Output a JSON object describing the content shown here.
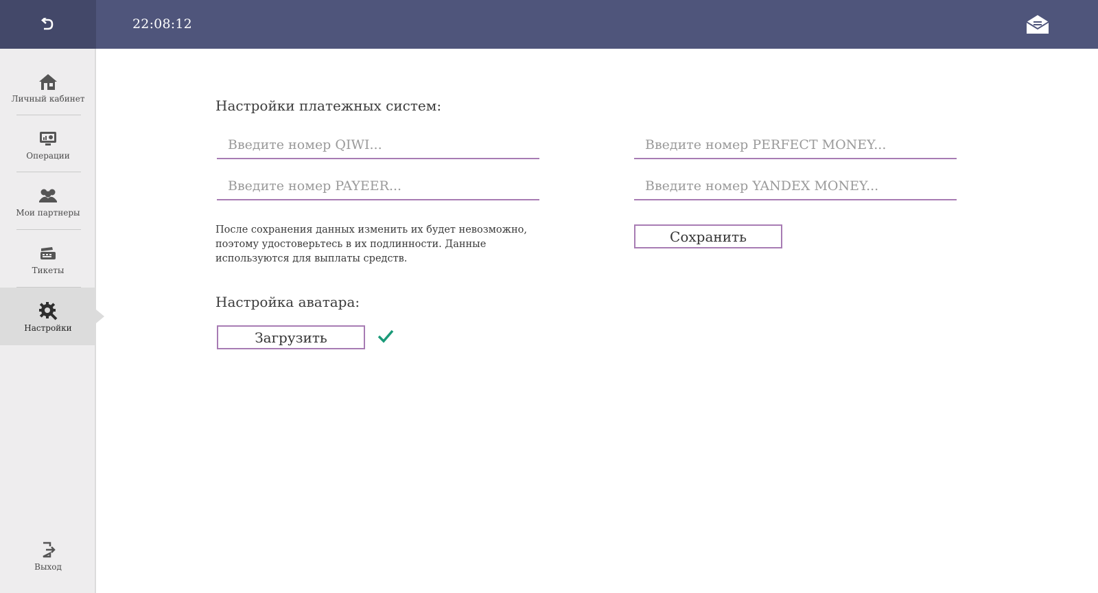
{
  "header": {
    "back_icon": "back-arrow-icon",
    "clock": "22:08:12",
    "mail_icon": "envelope-icon",
    "bg_color": "#4f557b"
  },
  "sidebar": {
    "items": [
      {
        "label": "Личный кабинет",
        "icon": "house-icon"
      },
      {
        "label": "Операции",
        "icon": "monitor-chart-icon"
      },
      {
        "label": "Мои партнеры",
        "icon": "people-icon"
      },
      {
        "label": "Тикеты",
        "icon": "ticket-icon"
      },
      {
        "label": "Настройки",
        "icon": "gear-wrench-icon",
        "active": true
      }
    ],
    "logout": {
      "label": "Выход",
      "icon": "logout-icon"
    }
  },
  "payments": {
    "title": "Настройки платежных систем:",
    "qiwi_placeholder": "Введите номер QIWI...",
    "perfect_placeholder": "Введите номер PERFECT MONEY...",
    "payeer_placeholder": "Введите номер PAYEER...",
    "yandex_placeholder": "Введите номер YANDEX MONEY...",
    "note": "После сохранения данных изменить их будет невозможно, поэтому удостоверьтесь в их подлинности. Данные используются для выплаты средств.",
    "save_label": "Сохранить"
  },
  "avatar": {
    "title": "Настройка аватара:",
    "upload_label": "Загрузить",
    "status_icon": "checkmark-icon",
    "status_color": "#1a9a78"
  },
  "accent_color": "#a77bb3"
}
